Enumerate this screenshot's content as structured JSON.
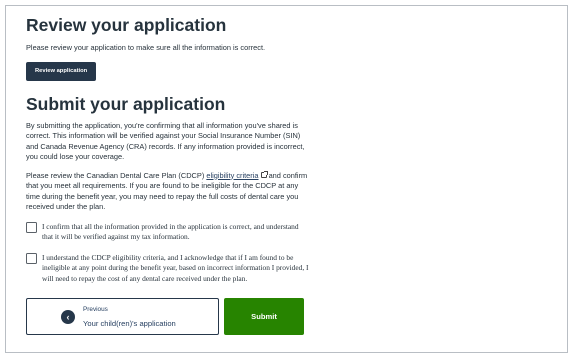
{
  "review": {
    "heading": "Review your application",
    "text": "Please review your application to make sure all the information is correct.",
    "button_label": "Review application"
  },
  "submit": {
    "heading": "Submit your application",
    "consent_text": "By submitting the application, you're confirming that all information you've shared is correct. This information will be verified against your Social Insurance Number (SIN) and Canada Revenue Agency (CRA) records. If any information provided is incorrect, you could lose your coverage.",
    "criteria_before": "Please review the Canadian Dental Care Plan (CDCP) ",
    "criteria_link": "eligibility criteria",
    "criteria_after": " and confirm that you meet all requirements. If you are found to be ineligible for the CDCP at any time during the benefit year, you may need to repay the full costs of dental care you received under the plan.",
    "checkbox_1": "I confirm that all the information provided in the application is correct, and understand that it will be verified against my tax information.",
    "checkbox_2": "I understand the CDCP eligibility criteria, and I acknowledge that if I am found to be ineligible at any point during the benefit year, based on incorrect information I provided, I will need to repay the cost of any dental care received under the plan."
  },
  "nav": {
    "previous_kicker": "Previous",
    "previous_title": "Your child(ren)'s application",
    "submit_label": "Submit"
  },
  "icons": {
    "external": "external-link-icon",
    "previous": "chevron-left-icon"
  },
  "colors": {
    "primary": "#26374a",
    "submit": "#278400",
    "link": "#284162"
  }
}
